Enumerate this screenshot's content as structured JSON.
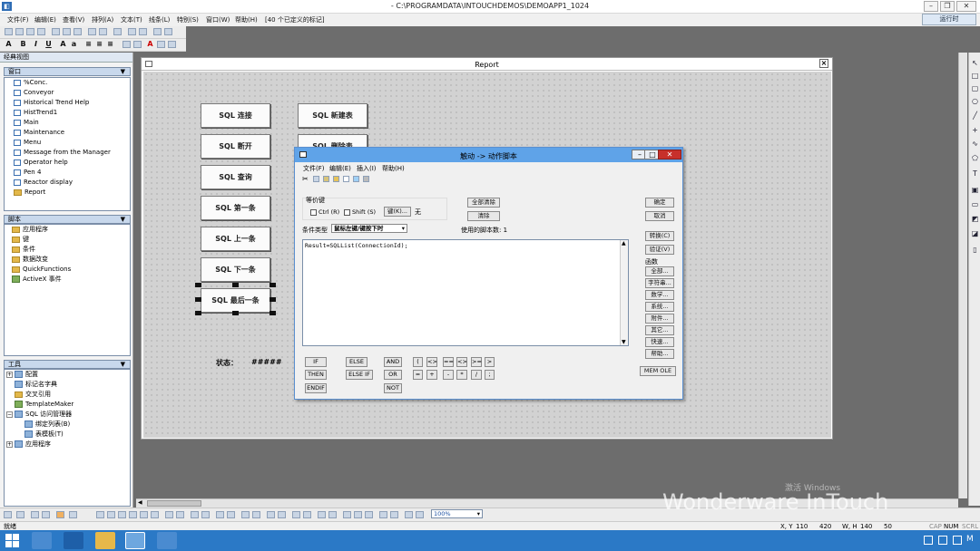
{
  "window": {
    "title": "- C:\\PROGRAMDATA\\INTOUCHDEMOS\\DEMOAPP1_1024"
  },
  "menu": {
    "items": [
      "文件(F)",
      "编辑(E)",
      "查看(V)",
      "排列(A)",
      "文本(T)",
      "线条(L)",
      "特别(S)",
      "窗口(W)",
      "帮助(H)"
    ],
    "object_count": "[40 个已定义的标记]"
  },
  "run_button": "运行时",
  "left_pane": {
    "title": "经典视图",
    "windows_section": {
      "label": "窗口",
      "items": [
        "%Conc.",
        "Conveyor",
        "Historical Trend Help",
        "HistTrend1",
        "Main",
        "Maintenance",
        "Menu",
        "Message from the Manager",
        "Operator help",
        "Pen 4",
        "Reactor display",
        "Report"
      ]
    },
    "scripts_section": {
      "label": "脚本",
      "items": [
        "应用程序",
        "键",
        "条件",
        "数据改变",
        "QuickFunctions",
        "ActiveX 事件"
      ]
    },
    "tools_section": {
      "label": "工具",
      "items": [
        "配置",
        "标记名字典",
        "交叉引用",
        "TemplateMaker",
        "SQL 访问管理器",
        "绑定列表(B)",
        "表模板(T)",
        "应用程序"
      ]
    }
  },
  "report_window": {
    "title": "Report",
    "buttons": [
      "SQL 连接",
      "SQL 断开",
      "SQL 查询",
      "SQL 第一条",
      "SQL 上一条",
      "SQL 下一条",
      "SQL 最后一条",
      "SQL 新建表",
      "SQL 删除表"
    ],
    "status_label": "状态：",
    "status_value": "#####"
  },
  "dialog": {
    "title": "触动 -> 动作脚本",
    "menu": [
      "文件(F)",
      "编辑(E)",
      "插入(I)",
      "帮助(H)"
    ],
    "equiv_key_label": "等价键",
    "ctrl_label": "Ctrl (R)",
    "shift_label": "Shift (S)",
    "key_button": "键(K)...",
    "key_value": "无",
    "clear_all_button": "全部清除",
    "clear_button": "清除",
    "condition_type_label": "条件类型",
    "condition_type_value": "鼠标左键/键按下时",
    "scripts_used": "使用的脚本数: 1",
    "script_text": "Result=SQLList(ConnectionId);",
    "ok_button": "确定",
    "cancel_button": "取消",
    "convert_button": "转换(C)",
    "validate_button": "验证(V)",
    "functions_label": "函数",
    "function_buttons": [
      "全部...",
      "字符串...",
      "数学...",
      "系统...",
      "附件...",
      "其它...",
      "快速...",
      "帮助..."
    ],
    "mem_ole_button": "MEM OLE",
    "keywords": [
      "IF",
      "ELSE",
      "AND",
      "THEN",
      "ELSE IF",
      "OR",
      "ENDIF",
      "NOT"
    ],
    "operators": [
      "(",
      "<>",
      "==",
      "<>",
      ">=",
      ">",
      "=",
      "+",
      "-",
      "*",
      "/",
      ";"
    ]
  },
  "zoom": "100%",
  "statusbar": {
    "ready": "就绪",
    "xy_label": "X, Y",
    "x": "110",
    "y": "420",
    "wh_label": "W, H",
    "w": "140",
    "h": "50",
    "caps": "CAP",
    "num": "NUM",
    "scrl": "SCRL"
  },
  "watermark": "Wonderware InTouch",
  "activate_text": "激活 Windows"
}
